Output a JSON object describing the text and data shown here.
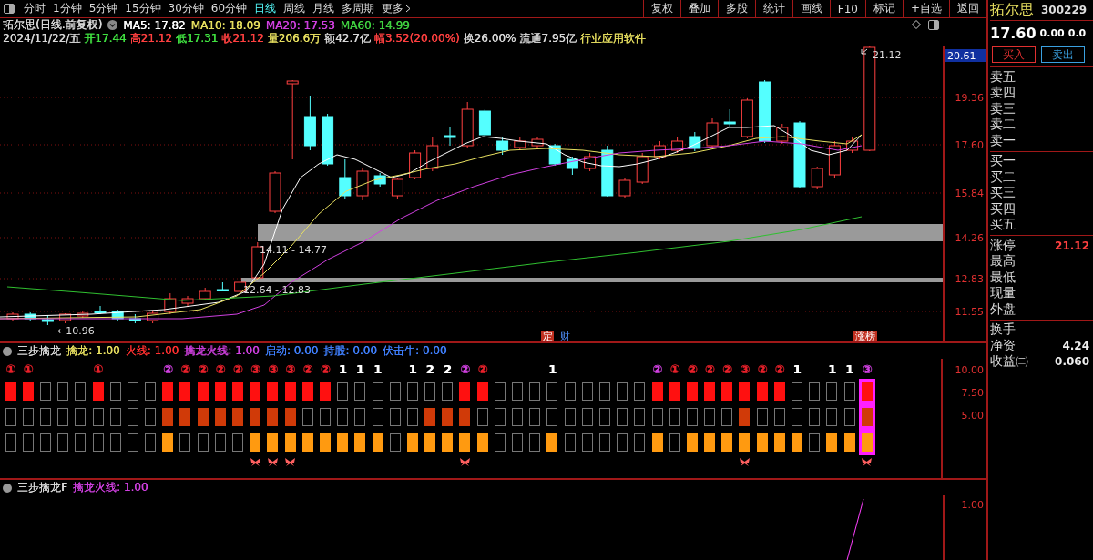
{
  "toolbar": {
    "period_tabs": [
      {
        "label": "分时",
        "selected": false
      },
      {
        "label": "1分钟",
        "selected": false
      },
      {
        "label": "5分钟",
        "selected": false
      },
      {
        "label": "15分钟",
        "selected": false
      },
      {
        "label": "30分钟",
        "selected": false
      },
      {
        "label": "60分钟",
        "selected": false
      },
      {
        "label": "日线",
        "selected": true
      },
      {
        "label": "周线",
        "selected": false
      },
      {
        "label": "月线",
        "selected": false
      },
      {
        "label": "多周期",
        "selected": false
      },
      {
        "label": "更多",
        "selected": false
      }
    ],
    "buttons": [
      "复权",
      "叠加",
      "多股",
      "统计",
      "画线",
      "F10",
      "标记",
      "+自选",
      "返回"
    ]
  },
  "chart_header": {
    "title": "拓尔思(日线.前复权)",
    "mas": [
      {
        "text": "MA5: 17.82",
        "color": "#ffffff"
      },
      {
        "text": "MA10: 18.09",
        "color": "#e8e060"
      },
      {
        "text": "MA20: 17.53",
        "color": "#d040e0"
      },
      {
        "text": "MA60: 14.99",
        "color": "#40d040"
      }
    ],
    "quote": [
      {
        "text": "2024/11/22/五",
        "color": "#d8d8d8"
      },
      {
        "text": "开17.44",
        "color": "#40e040"
      },
      {
        "text": "高21.12",
        "color": "#ff4040"
      },
      {
        "text": "低17.31",
        "color": "#40e040"
      },
      {
        "text": "收21.12",
        "color": "#ff4040"
      },
      {
        "text": "量206.6万",
        "color": "#e8e060"
      },
      {
        "text": "额42.7亿",
        "color": "#d8d8d8"
      },
      {
        "text": "幅3.52(20.00%)",
        "color": "#ff4040"
      },
      {
        "text": "换26.00%",
        "color": "#d8d8d8"
      },
      {
        "text": "流通7.95亿",
        "color": "#d8d8d8"
      },
      {
        "text": "行业应用软件",
        "color": "#e8e060"
      }
    ]
  },
  "price_axis": {
    "current": "20.61",
    "ticks": [
      "19.36",
      "17.60",
      "15.84",
      "14.26",
      "12.83",
      "11.55"
    ]
  },
  "annotations": {
    "high": "21.12",
    "low": "←10.96",
    "zones": [
      "14.11 - 14.77",
      "12.64 - 12.83"
    ],
    "markers": [
      {
        "text": "定",
        "kind": "box"
      },
      {
        "text": "财",
        "kind": "plain"
      },
      {
        "text": "涨榜",
        "kind": "box"
      }
    ]
  },
  "indicator": {
    "title": "三步擒龙",
    "values": [
      {
        "text": "擒龙: 1.00",
        "color": "#e8e060"
      },
      {
        "text": "火线: 1.00",
        "color": "#ff3030"
      },
      {
        "text": "擒龙火线: 1.00",
        "color": "#d040e0"
      },
      {
        "text": "启动: 0.00",
        "color": "#4080ff"
      },
      {
        "text": "持股: 0.00",
        "color": "#4080ff"
      },
      {
        "text": "伏击牛: 0.00",
        "color": "#4080ff"
      }
    ],
    "axis": [
      "10.00",
      "7.50",
      "5.00"
    ],
    "columns": [
      {
        "signal": {
          "text": "①",
          "color": "#e8202a"
        },
        "row_1": true,
        "row_2": false,
        "row_3": false,
        "butterfly": false,
        "highlight": false
      },
      {
        "signal": {
          "text": "①",
          "color": "#e8202a"
        },
        "row_1": true,
        "row_2": false,
        "row_3": false,
        "butterfly": false,
        "highlight": false
      },
      {
        "row_1": false,
        "row_2": false,
        "row_3": false,
        "butterfly": false,
        "highlight": false
      },
      {
        "row_1": false,
        "row_2": false,
        "row_3": false,
        "butterfly": false,
        "highlight": false
      },
      {
        "row_1": false,
        "row_2": false,
        "row_3": false,
        "butterfly": false,
        "highlight": false
      },
      {
        "signal": {
          "text": "①",
          "color": "#e8202a"
        },
        "row_1": true,
        "row_2": false,
        "row_3": false,
        "butterfly": false,
        "highlight": false
      },
      {
        "row_1": false,
        "row_2": false,
        "row_3": false,
        "butterfly": false,
        "highlight": false
      },
      {
        "row_1": false,
        "row_2": false,
        "row_3": false,
        "butterfly": false,
        "highlight": false
      },
      {
        "row_1": false,
        "row_2": false,
        "row_3": false,
        "butterfly": false,
        "highlight": false
      },
      {
        "signal": {
          "text": "②",
          "color": "#d040e0"
        },
        "row_1": true,
        "row_2": true,
        "row_3": true,
        "butterfly": false,
        "highlight": false
      },
      {
        "signal": {
          "text": "②",
          "color": "#e8202a"
        },
        "row_1": true,
        "row_2": true,
        "row_3": false,
        "butterfly": false,
        "highlight": false
      },
      {
        "signal": {
          "text": "②",
          "color": "#e8202a"
        },
        "row_1": true,
        "row_2": true,
        "row_3": false,
        "butterfly": false,
        "highlight": false
      },
      {
        "signal": {
          "text": "②",
          "color": "#e8202a"
        },
        "row_1": true,
        "row_2": true,
        "row_3": false,
        "butterfly": false,
        "highlight": false
      },
      {
        "signal": {
          "text": "②",
          "color": "#e8202a"
        },
        "row_1": true,
        "row_2": true,
        "row_3": false,
        "butterfly": false,
        "highlight": false
      },
      {
        "signal": {
          "text": "③",
          "color": "#e8202a"
        },
        "row_1": true,
        "row_2": true,
        "row_3": true,
        "butterfly": true,
        "highlight": false
      },
      {
        "signal": {
          "text": "③",
          "color": "#e8202a"
        },
        "row_1": true,
        "row_2": true,
        "row_3": true,
        "butterfly": true,
        "highlight": false
      },
      {
        "signal": {
          "text": "③",
          "color": "#e8202a"
        },
        "row_1": true,
        "row_2": true,
        "row_3": true,
        "butterfly": true,
        "highlight": false
      },
      {
        "signal": {
          "text": "②",
          "color": "#e8202a"
        },
        "row_1": true,
        "row_2": false,
        "row_3": true,
        "butterfly": false,
        "highlight": false
      },
      {
        "signal": {
          "text": "②",
          "color": "#e8202a"
        },
        "row_1": true,
        "row_2": false,
        "row_3": true,
        "butterfly": false,
        "highlight": false
      },
      {
        "signal": {
          "text": "1",
          "color": "#ffffff"
        },
        "row_1": false,
        "row_2": false,
        "row_3": true,
        "butterfly": false,
        "highlight": false
      },
      {
        "signal": {
          "text": "1",
          "color": "#ffffff"
        },
        "row_1": false,
        "row_2": false,
        "row_3": true,
        "butterfly": false,
        "highlight": false
      },
      {
        "signal": {
          "text": "1",
          "color": "#ffffff"
        },
        "row_1": false,
        "row_2": false,
        "row_3": true,
        "butterfly": false,
        "highlight": false
      },
      {
        "row_1": false,
        "row_2": false,
        "row_3": false,
        "butterfly": false,
        "highlight": false
      },
      {
        "signal": {
          "text": "1",
          "color": "#ffffff"
        },
        "row_1": false,
        "row_2": false,
        "row_3": true,
        "butterfly": false,
        "highlight": false
      },
      {
        "signal": {
          "text": "2",
          "color": "#ffffff"
        },
        "row_1": false,
        "row_2": true,
        "row_3": true,
        "butterfly": false,
        "highlight": false
      },
      {
        "signal": {
          "text": "2",
          "color": "#ffffff"
        },
        "row_1": false,
        "row_2": true,
        "row_3": true,
        "butterfly": false,
        "highlight": false
      },
      {
        "signal": {
          "text": "②",
          "color": "#d040e0"
        },
        "row_1": true,
        "row_2": true,
        "row_3": true,
        "butterfly": true,
        "highlight": false
      },
      {
        "signal": {
          "text": "②",
          "color": "#e8202a"
        },
        "row_1": true,
        "row_2": false,
        "row_3": true,
        "butterfly": false,
        "highlight": false
      },
      {
        "row_1": false,
        "row_2": false,
        "row_3": false,
        "butterfly": false,
        "highlight": false
      },
      {
        "row_1": false,
        "row_2": false,
        "row_3": false,
        "butterfly": false,
        "highlight": false
      },
      {
        "row_1": false,
        "row_2": false,
        "row_3": false,
        "butterfly": false,
        "highlight": false
      },
      {
        "signal": {
          "text": "1",
          "color": "#ffffff"
        },
        "row_1": false,
        "row_2": false,
        "row_3": true,
        "butterfly": false,
        "highlight": false
      },
      {
        "row_1": false,
        "row_2": false,
        "row_3": false,
        "butterfly": false,
        "highlight": false
      },
      {
        "row_1": false,
        "row_2": false,
        "row_3": false,
        "butterfly": false,
        "highlight": false
      },
      {
        "row_1": false,
        "row_2": false,
        "row_3": false,
        "butterfly": false,
        "highlight": false
      },
      {
        "row_1": false,
        "row_2": false,
        "row_3": false,
        "butterfly": false,
        "highlight": false
      },
      {
        "row_1": false,
        "row_2": false,
        "row_3": false,
        "butterfly": false,
        "highlight": false
      },
      {
        "signal": {
          "text": "②",
          "color": "#d040e0"
        },
        "row_1": true,
        "row_2": false,
        "row_3": true,
        "butterfly": false,
        "highlight": false
      },
      {
        "signal": {
          "text": "①",
          "color": "#e8202a"
        },
        "row_1": true,
        "row_2": false,
        "row_3": false,
        "butterfly": false,
        "highlight": false
      },
      {
        "signal": {
          "text": "②",
          "color": "#e8202a"
        },
        "row_1": true,
        "row_2": false,
        "row_3": true,
        "butterfly": false,
        "highlight": false
      },
      {
        "signal": {
          "text": "②",
          "color": "#e8202a"
        },
        "row_1": true,
        "row_2": false,
        "row_3": true,
        "butterfly": false,
        "highlight": false
      },
      {
        "signal": {
          "text": "②",
          "color": "#e8202a"
        },
        "row_1": true,
        "row_2": false,
        "row_3": true,
        "butterfly": false,
        "highlight": false
      },
      {
        "signal": {
          "text": "③",
          "color": "#e8202a"
        },
        "row_1": true,
        "row_2": true,
        "row_3": true,
        "butterfly": true,
        "highlight": false
      },
      {
        "signal": {
          "text": "②",
          "color": "#e8202a"
        },
        "row_1": true,
        "row_2": false,
        "row_3": true,
        "butterfly": false,
        "highlight": false
      },
      {
        "signal": {
          "text": "②",
          "color": "#e8202a"
        },
        "row_1": true,
        "row_2": false,
        "row_3": true,
        "butterfly": false,
        "highlight": false
      },
      {
        "signal": {
          "text": "1",
          "color": "#ffffff"
        },
        "row_1": false,
        "row_2": false,
        "row_3": true,
        "butterfly": false,
        "highlight": false
      },
      {
        "row_1": false,
        "row_2": false,
        "row_3": false,
        "butterfly": false,
        "highlight": false
      },
      {
        "signal": {
          "text": "1",
          "color": "#ffffff"
        },
        "row_1": false,
        "row_2": false,
        "row_3": true,
        "butterfly": false,
        "highlight": false
      },
      {
        "signal": {
          "text": "1",
          "color": "#ffffff"
        },
        "row_1": false,
        "row_2": false,
        "row_3": true,
        "butterfly": false,
        "highlight": false
      },
      {
        "signal": {
          "text": "③",
          "color": "#d040e0"
        },
        "row_1": true,
        "row_2": true,
        "row_3": true,
        "butterfly": true,
        "highlight": true
      }
    ]
  },
  "indicator_f": {
    "title": "三步擒龙F",
    "values": [
      {
        "text": "擒龙火线: 1.00",
        "color": "#d040e0"
      }
    ],
    "axis": [
      "1.00"
    ]
  },
  "quote_panel": {
    "name": "拓尔思",
    "code": "300229",
    "price": "17.60",
    "change": "0.00",
    "change_pct": "0.0",
    "buy_button": "买入",
    "sell_button": "卖出",
    "asks": [
      "卖五",
      "卖四",
      "卖三",
      "卖二",
      "卖一"
    ],
    "bids": [
      "买一",
      "买二",
      "买三",
      "买四",
      "买五"
    ],
    "stats": [
      {
        "label": "涨停",
        "value": "21.12",
        "kind": "limit"
      },
      {
        "label": "最高"
      },
      {
        "label": "最低"
      },
      {
        "label": "现量"
      },
      {
        "label": "外盘"
      }
    ],
    "finance": [
      {
        "label": "换手"
      },
      {
        "label": "净资",
        "value": "4.24"
      },
      {
        "label": "收益㈢",
        "value": "0.060"
      }
    ]
  }
}
